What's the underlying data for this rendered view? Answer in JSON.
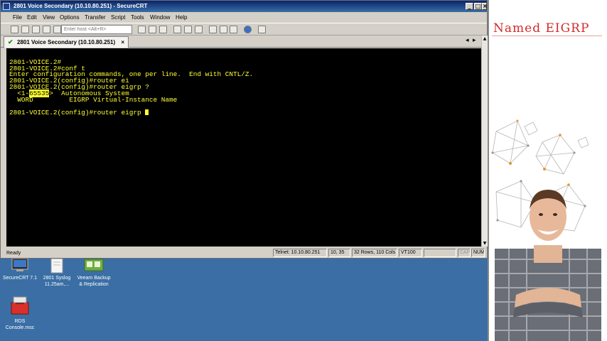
{
  "window": {
    "title": "2801 Voice Secondary (10.10.80.251) - SecureCRT",
    "buttons": {
      "minimize": "_",
      "maximize": "□",
      "close": "×"
    }
  },
  "menu": [
    "File",
    "Edit",
    "View",
    "Options",
    "Transfer",
    "Script",
    "Tools",
    "Window",
    "Help"
  ],
  "toolbar": {
    "host_placeholder": "Enter host <Alt+R>"
  },
  "tab": {
    "label": "2801 Voice Secondary (10.10.80.251)",
    "close": "×"
  },
  "terminal": {
    "lines": [
      "2801-VOICE.2#",
      "2801-VOICE.2#conf t",
      "Enter configuration commands, one per line.  End with CNTL/Z.",
      "2801-VOICE.2(config)#router ei",
      "2801-VOICE.2(config)#router eigrp ?"
    ],
    "help1_prefix": "  <1-",
    "help1_highlight": "65535",
    "help1_suffix": ">  Autonomous System",
    "help2": "  WORD         EIGRP Virtual-Instance Name",
    "blank": "",
    "current": "2801-VOICE.2(config)#router eigrp "
  },
  "status": {
    "ready": "Ready",
    "telnet": "Telnet: 10.10.80.251",
    "position": "10,  35",
    "size": "32 Rows, 110 Cols",
    "emulation": "VT100",
    "cap": "CAP",
    "num": "NUM"
  },
  "desktop_icons": [
    {
      "label1": "SecureCRT 7.1",
      "label2": ""
    },
    {
      "label1": "2801 Syslog",
      "label2": "11.25am,..."
    },
    {
      "label1": "Veeam Backup",
      "label2": "& Replication"
    },
    {
      "label1": "RDS",
      "label2": "Console.msc"
    }
  ],
  "slide": {
    "heading": "Named EIGRP"
  },
  "colors": {
    "terminal_bg": "#000000",
    "terminal_fg": "#ffff33",
    "heading": "#d32a2a",
    "desktop": "#3a6ea5"
  }
}
